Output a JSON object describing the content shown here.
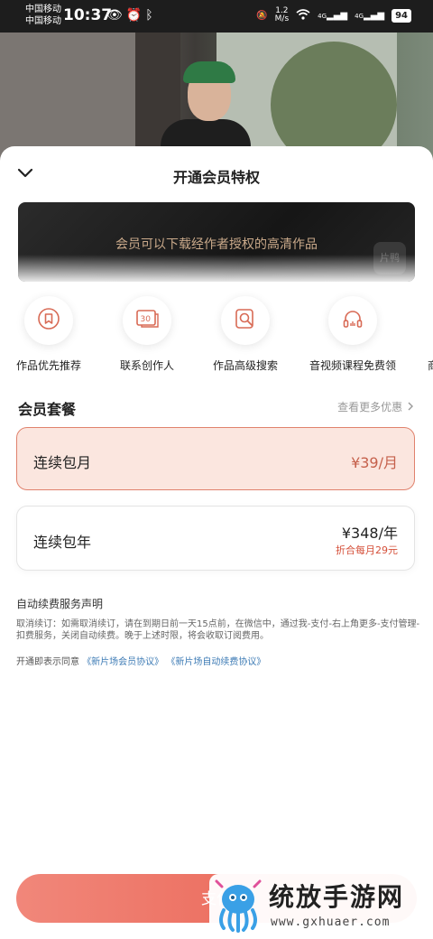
{
  "status_bar": {
    "carrier_1": "中国移动",
    "carrier_2": "中国移动",
    "time": "10:37",
    "net_speed_value": "1.2",
    "net_speed_unit": "M/s",
    "signal_label_1": "4G",
    "signal_label_2": "4G",
    "battery": "94",
    "icons": [
      "eye-icon",
      "alarm-icon",
      "bluetooth-icon",
      "mute-icon",
      "wifi-icon",
      "signal-icon"
    ]
  },
  "sheet": {
    "title": "开通会员特权"
  },
  "banner": {
    "text": "会员可以下载经作者授权的高清作品",
    "logo_text": "片鸭"
  },
  "features": [
    {
      "label": "作品优先推荐",
      "icon": "bookmark-icon"
    },
    {
      "label": "联系创作人",
      "icon": "chat-icon"
    },
    {
      "label": "作品高级搜索",
      "icon": "search-icon"
    },
    {
      "label": "音视频课程免费领",
      "icon": "headphones-icon"
    },
    {
      "label": "商",
      "icon": ""
    }
  ],
  "packages": {
    "title": "会员套餐",
    "more": "查看更多优惠",
    "monthly": {
      "name": "连续包月",
      "price": "¥39/月"
    },
    "yearly": {
      "name": "连续包年",
      "price": "¥348/年",
      "sub": "折合每月29元"
    }
  },
  "notice": {
    "title": "自动续费服务声明",
    "body": "取消续订：如需取消续订，请在到期日前一天15点前，在微信中，通过我-支付-右上角更多-支付管理-扣费服务，关闭自动续费。晚于上述时限，将会收取订阅费用。",
    "agreement_prefix": "开通即表示同意",
    "link_1": "《新片场会员协议》",
    "link_2": "《新片场自动续费协议》"
  },
  "pay_button": {
    "label": "支付"
  },
  "watermark": {
    "text": "统放手游网",
    "url": "www.gxhuaer.com"
  },
  "colors": {
    "accent": "#e85d4d",
    "selected_bg": "#fbe6df",
    "link": "#3d7bb5",
    "banner_text": "#c9a98a"
  }
}
